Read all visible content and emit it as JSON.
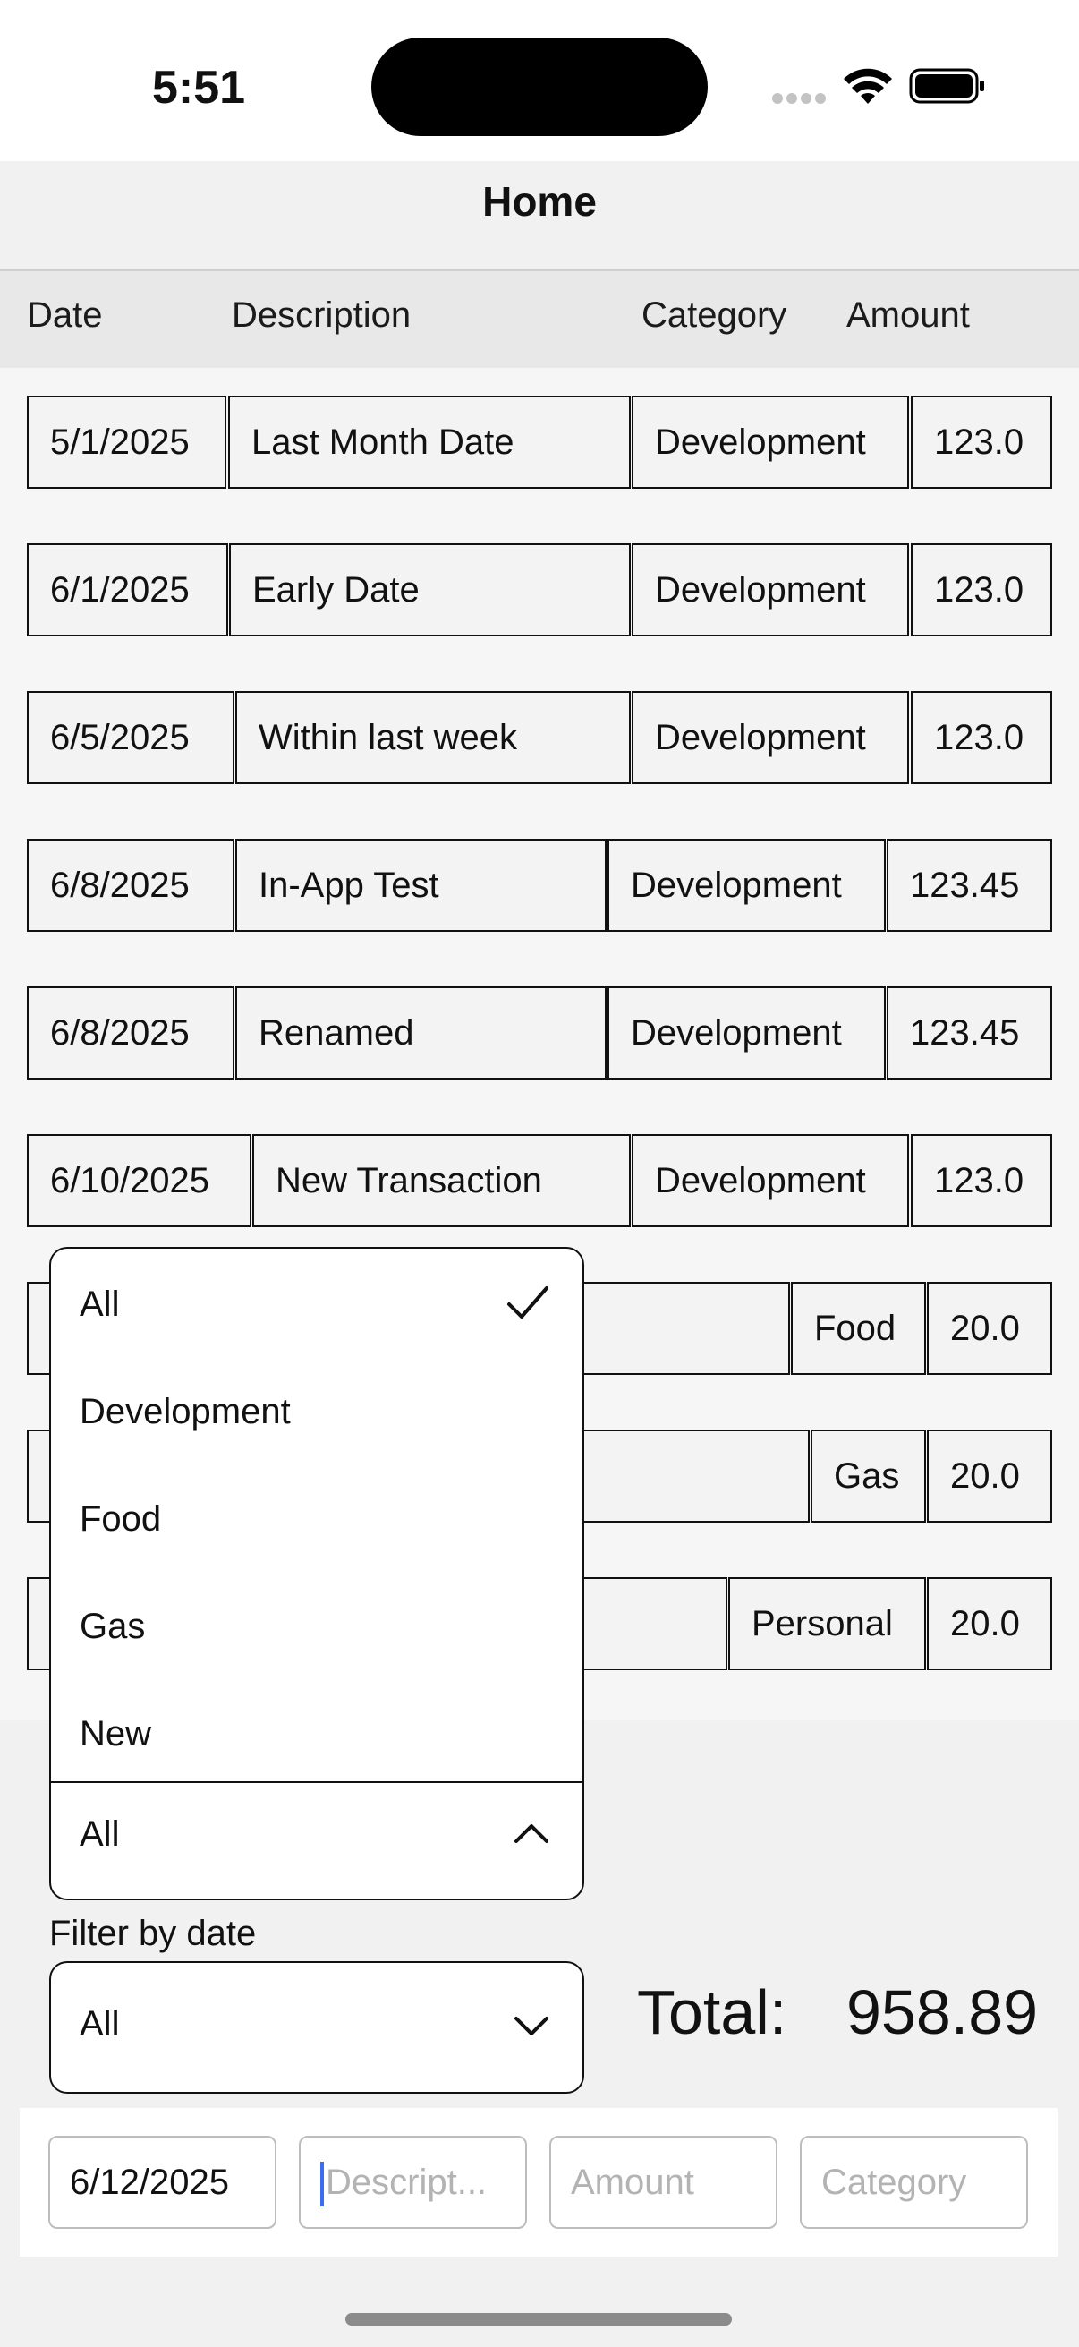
{
  "status": {
    "time": "5:51"
  },
  "nav": {
    "title": "Home"
  },
  "table": {
    "headers": {
      "date": "Date",
      "description": "Description",
      "category": "Category",
      "amount": "Amount"
    },
    "rows": [
      {
        "date": "5/1/2025",
        "description": "Last Month Date",
        "category": "Development",
        "amount": "123.0"
      },
      {
        "date": "6/1/2025",
        "description": "Early Date",
        "category": "Development",
        "amount": "123.0"
      },
      {
        "date": "6/5/2025",
        "description": "Within last week",
        "category": "Development",
        "amount": "123.0"
      },
      {
        "date": "6/8/2025",
        "description": "In-App Test",
        "category": "Development",
        "amount": "123.45"
      },
      {
        "date": "6/8/2025",
        "description": "Renamed",
        "category": "Development",
        "amount": "123.45"
      },
      {
        "date": "6/10/2025",
        "description": "New Transaction",
        "category": "Development",
        "amount": "123.0"
      },
      {
        "date": "",
        "description": "",
        "category": "Food",
        "amount": "20.0"
      },
      {
        "date": "",
        "description": "",
        "category": "Gas",
        "amount": "20.0"
      },
      {
        "date": "",
        "description": "",
        "category": "Personal",
        "amount": "20.0"
      }
    ]
  },
  "category_dropdown": {
    "options": [
      "All",
      "Development",
      "Food",
      "Gas",
      "New"
    ],
    "checked_index": 0,
    "selected": "All"
  },
  "date_filter": {
    "label": "Filter by date",
    "selected": "All"
  },
  "total": {
    "label": "Total:",
    "value": "958.89"
  },
  "add_form": {
    "date_value": "6/12/2025",
    "description_placeholder": "Descript...",
    "amount_placeholder": "Amount",
    "category_placeholder": "Category"
  }
}
